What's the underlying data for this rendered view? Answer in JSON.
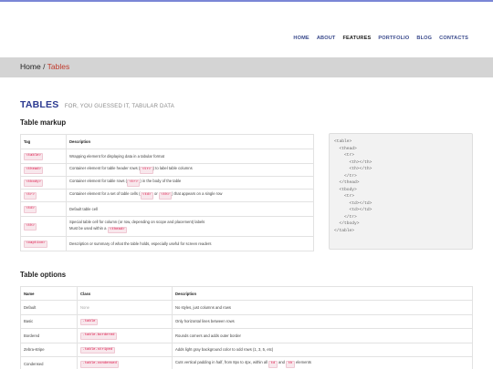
{
  "nav": [
    "HOME",
    "ABOUT",
    "FEATURES",
    "PORTFOLIO",
    "BLOG",
    "CONTACTS"
  ],
  "nav_active": "FEATURES",
  "breadcrumb": {
    "home": "Home",
    "separator": "/",
    "current": "Tables"
  },
  "page": {
    "title": "TABLES",
    "subtitle": "FOR, YOU GUESSED IT, TABULAR DATA"
  },
  "markup": {
    "title": "Table markup",
    "headers": [
      "Tag",
      "Description"
    ],
    "rows": [
      {
        "tag": "<table>",
        "desc": [
          "Wrapping element for displaying data in a tabular format"
        ]
      },
      {
        "tag": "<thead>",
        "desc": [
          "Container element for table header rows (",
          {
            "c": "<tr>"
          },
          ") to label table columns"
        ]
      },
      {
        "tag": "<tbody>",
        "desc": [
          "Container element for table rows (",
          {
            "c": "<tr>"
          },
          ") in the body of the table"
        ]
      },
      {
        "tag": "<tr>",
        "desc": [
          "Container element for a set of table cells (",
          {
            "c": "<td>"
          },
          " or ",
          {
            "c": "<th>"
          },
          ") that appears on a single row"
        ]
      },
      {
        "tag": "<td>",
        "desc": [
          "Default table cell"
        ]
      },
      {
        "tag": "<th>",
        "desc": [
          "Special table cell for column (or row, depending on scope and placement) labels"
        ],
        "desc2": [
          "Must be used within a ",
          {
            "c": "<thead>"
          }
        ]
      },
      {
        "tag": "<caption>",
        "desc": [
          "Description or summary of what the table holds, especially useful for screen readers"
        ]
      }
    ],
    "code_sample": "<table>\n  <thead>\n    <tr>\n      <th></th>\n      <th></th>\n    </tr>\n  </thead>\n  <tbody>\n    <tr>\n      <td></td>\n      <td></td>\n    </tr>\n  </tbody>\n</table>"
  },
  "options": {
    "title": "Table options",
    "headers": [
      "Name",
      "Class",
      "Description"
    ],
    "rows": [
      {
        "name": "Default",
        "class": "None",
        "desc": [
          "No styles, just columns and rows"
        ]
      },
      {
        "name": "Basic",
        "class": ".table",
        "desc": [
          "Only horizontal lines between rows"
        ]
      },
      {
        "name": "Bordered",
        "class": ".table-bordered",
        "desc": [
          "Rounds corners and adds outer border"
        ]
      },
      {
        "name": "Zebra-stripe",
        "class": ".table-striped",
        "desc": [
          "Adds light gray background color to odd rows (1, 3, 5, etc)"
        ]
      },
      {
        "name": "Condensed",
        "class": ".table-condensed",
        "desc": [
          "Cuts vertical padding in half, from 8px to 4px, within all ",
          {
            "c": "td"
          },
          " and ",
          {
            "c": "th"
          },
          " elements"
        ]
      }
    ]
  }
}
